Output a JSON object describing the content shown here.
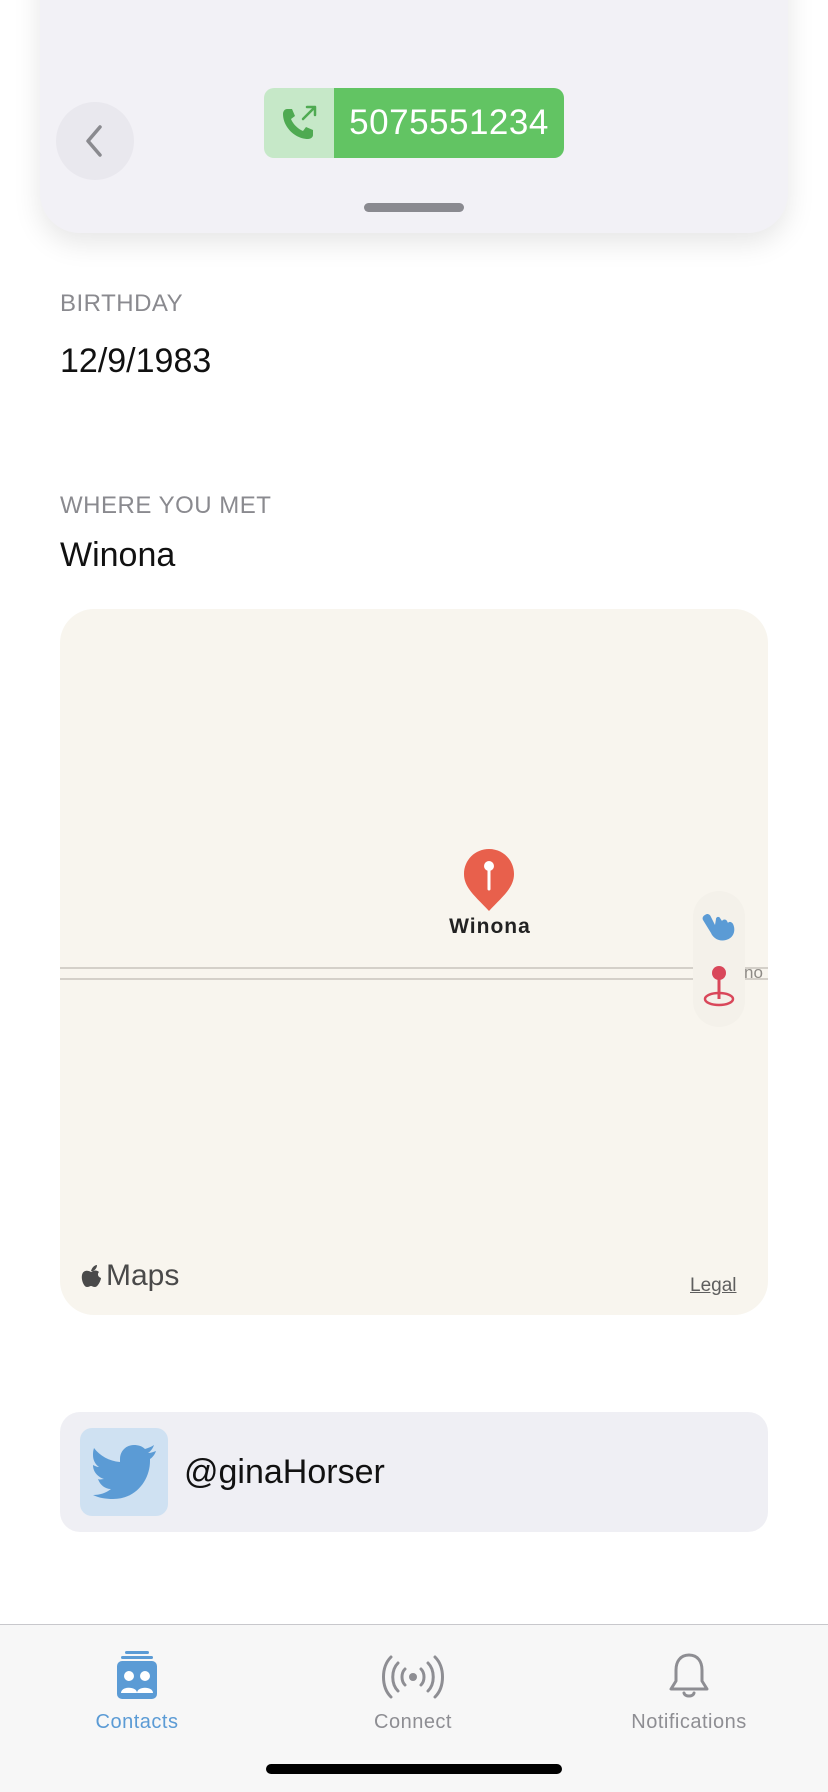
{
  "contact": {
    "phone": "5075551234",
    "birthday_label": "BIRTHDAY",
    "birthday": "12/9/1983",
    "met_label": "WHERE YOU MET",
    "met_place": "Winona",
    "twitter_handle": "@ginaHorser"
  },
  "map": {
    "pin_label": "Winona",
    "road_text": "no",
    "brand": "Maps",
    "legal": "Legal"
  },
  "tabbar": {
    "tabs": [
      {
        "label": "Contacts",
        "icon": "contacts-icon",
        "active": true
      },
      {
        "label": "Connect",
        "icon": "broadcast-icon",
        "active": false
      },
      {
        "label": "Notifications",
        "icon": "bell-icon",
        "active": false
      }
    ]
  },
  "colors": {
    "accent": "#5b9bd5",
    "call_green": "#62c463",
    "pin_red": "#e8604c"
  }
}
